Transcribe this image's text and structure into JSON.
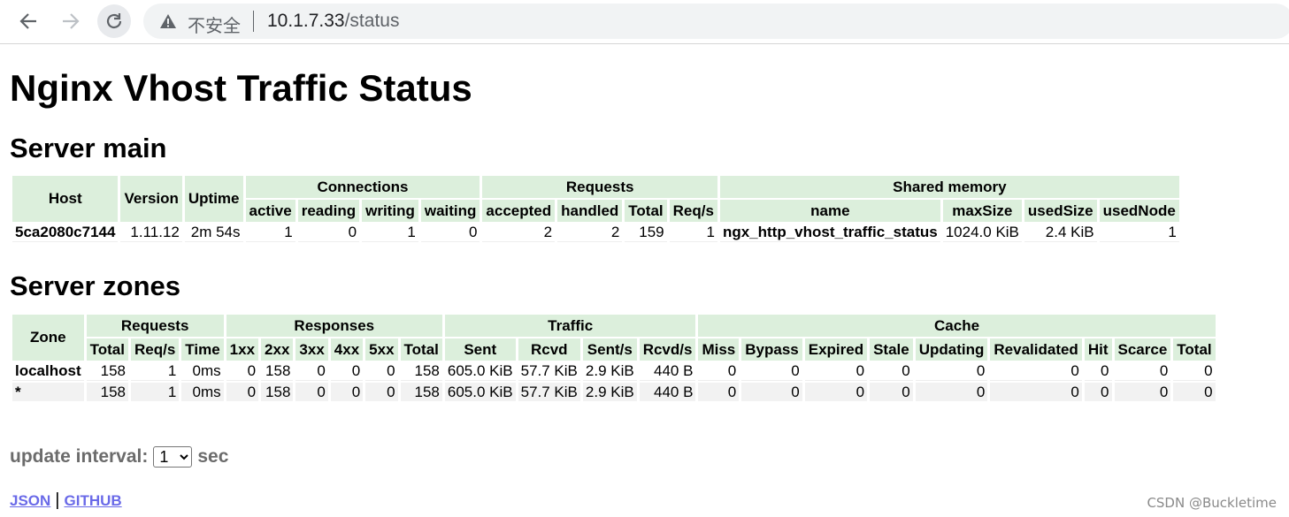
{
  "browser": {
    "security_label": "不安全",
    "url_host": "10.1.7.33",
    "url_path": "/status"
  },
  "page": {
    "title": "Nginx Vhost Traffic Status"
  },
  "server_main": {
    "heading": "Server main",
    "group_headers": [
      "Connections",
      "Requests",
      "Shared memory"
    ],
    "headers": {
      "host": "Host",
      "version": "Version",
      "uptime": "Uptime",
      "connections": [
        "active",
        "reading",
        "writing",
        "waiting"
      ],
      "requests": [
        "accepted",
        "handled",
        "Total",
        "Req/s"
      ],
      "shared": [
        "name",
        "maxSize",
        "usedSize",
        "usedNode"
      ]
    },
    "row": {
      "host": "5ca2080c7144",
      "version": "1.11.12",
      "uptime": "2m 54s",
      "active": "1",
      "reading": "0",
      "writing": "1",
      "waiting": "0",
      "accepted": "2",
      "handled": "2",
      "total": "159",
      "req_s": "1",
      "shm_name": "ngx_http_vhost_traffic_status",
      "max_size": "1024.0 KiB",
      "used_size": "2.4 KiB",
      "used_node": "1"
    }
  },
  "server_zones": {
    "heading": "Server zones",
    "zone_header": "Zone",
    "group_headers": [
      "Requests",
      "Responses",
      "Traffic",
      "Cache"
    ],
    "sub_headers": [
      "Total",
      "Req/s",
      "Time",
      "1xx",
      "2xx",
      "3xx",
      "4xx",
      "5xx",
      "Total",
      "Sent",
      "Rcvd",
      "Sent/s",
      "Rcvd/s",
      "Miss",
      "Bypass",
      "Expired",
      "Stale",
      "Updating",
      "Revalidated",
      "Hit",
      "Scarce",
      "Total"
    ],
    "rows": [
      {
        "zone": "localhost",
        "cells": [
          "158",
          "1",
          "0ms",
          "0",
          "158",
          "0",
          "0",
          "0",
          "158",
          "605.0 KiB",
          "57.7 KiB",
          "2.9 KiB",
          "440 B",
          "0",
          "0",
          "0",
          "0",
          "0",
          "0",
          "0",
          "0",
          "0"
        ]
      },
      {
        "zone": "*",
        "cells": [
          "158",
          "1",
          "0ms",
          "0",
          "158",
          "0",
          "0",
          "0",
          "158",
          "605.0 KiB",
          "57.7 KiB",
          "2.9 KiB",
          "440 B",
          "0",
          "0",
          "0",
          "0",
          "0",
          "0",
          "0",
          "0",
          "0"
        ]
      }
    ]
  },
  "update": {
    "label": "update interval:",
    "selected": "1",
    "unit": "sec"
  },
  "footer": {
    "json_link": "JSON",
    "separator": "|",
    "github_link": "GITHUB"
  },
  "watermark": "CSDN @Buckletime",
  "colors": {
    "header_bg": "#dcefdc",
    "link": "#6a6ae8"
  }
}
